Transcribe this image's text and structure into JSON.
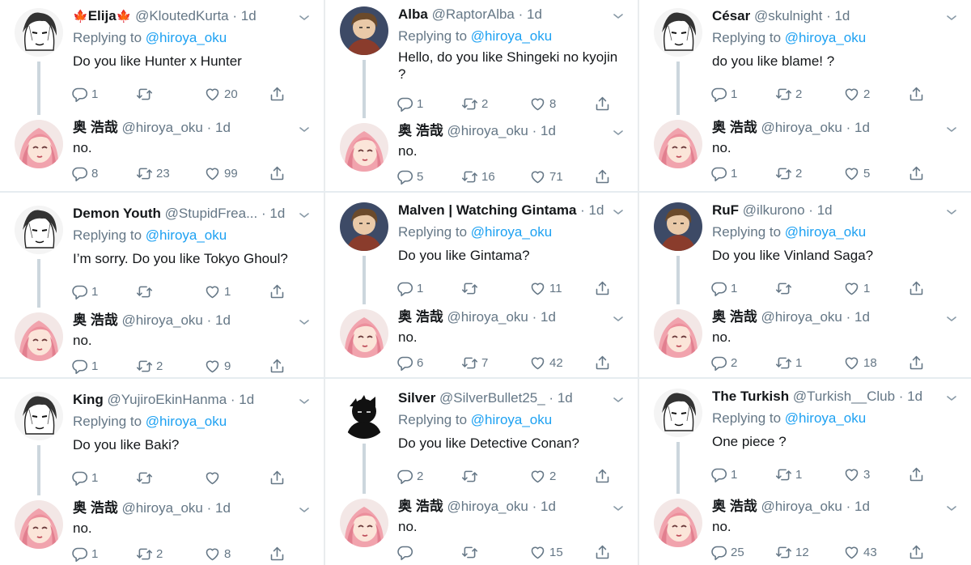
{
  "colors": {
    "link": "#1da1f2",
    "muted": "#657786",
    "text": "#14171a",
    "thread": "#ccd6dd"
  },
  "tiles": [
    {
      "question": {
        "name": "Elija",
        "name_emoji": "maple-leaf",
        "handle": "@KloutedKurta",
        "time": "1d",
        "replying_label": "Replying to",
        "mention": "@hiroya_oku",
        "text": "Do you like Hunter x Hunter",
        "stats": {
          "reply": "1",
          "retweet": "",
          "like": "20"
        },
        "avatar_icon": "manga-face-icon"
      },
      "answer": {
        "name": "奥 浩哉",
        "handle": "@hiroya_oku",
        "time": "1d",
        "text": "no.",
        "stats": {
          "reply": "8",
          "retweet": "23",
          "like": "99"
        },
        "avatar_icon": "pink-hair-avatar"
      }
    },
    {
      "question": {
        "name": "Alba",
        "handle": "@RaptorAlba",
        "time": "1d",
        "replying_label": "Replying to",
        "mention": "@hiroya_oku",
        "text": "Hello, do you like Shingeki no kyojin ?",
        "stats": {
          "reply": "1",
          "retweet": "2",
          "like": "8"
        },
        "avatar_icon": "anime-character-icon"
      },
      "answer": {
        "name": "奥 浩哉",
        "handle": "@hiroya_oku",
        "time": "1d",
        "text": "no.",
        "stats": {
          "reply": "5",
          "retweet": "16",
          "like": "71"
        },
        "avatar_icon": "pink-hair-avatar"
      }
    },
    {
      "question": {
        "name": "César",
        "handle": "@skulnight",
        "time": "1d",
        "replying_label": "Replying to",
        "mention": "@hiroya_oku",
        "text": "do you like blame! ?",
        "stats": {
          "reply": "1",
          "retweet": "2",
          "like": "2"
        },
        "avatar_icon": "manga-face-icon"
      },
      "answer": {
        "name": "奥 浩哉",
        "handle": "@hiroya_oku",
        "time": "1d",
        "text": "no.",
        "stats": {
          "reply": "1",
          "retweet": "2",
          "like": "5"
        },
        "avatar_icon": "pink-hair-avatar"
      }
    },
    {
      "question": {
        "name": "Demon Youth",
        "handle": "@StupidFrea...",
        "time": "1d",
        "replying_label": "Replying to",
        "mention": "@hiroya_oku",
        "text": "I’m sorry. Do you like Tokyo Ghoul?",
        "stats": {
          "reply": "1",
          "retweet": "",
          "like": "1"
        },
        "avatar_icon": "manga-face-icon"
      },
      "answer": {
        "name": "奥 浩哉",
        "handle": "@hiroya_oku",
        "time": "1d",
        "text": "no.",
        "stats": {
          "reply": "1",
          "retweet": "2",
          "like": "9"
        },
        "avatar_icon": "pink-hair-avatar"
      }
    },
    {
      "question": {
        "name": "Malven | Watching Gintama",
        "handle": "",
        "time": "1d",
        "replying_label": "Replying to",
        "mention": "@hiroya_oku",
        "text": "Do you like Gintama?",
        "stats": {
          "reply": "1",
          "retweet": "",
          "like": "11"
        },
        "avatar_icon": "anime-character-icon"
      },
      "answer": {
        "name": "奥 浩哉",
        "handle": "@hiroya_oku",
        "time": "1d",
        "text": "no.",
        "stats": {
          "reply": "6",
          "retweet": "7",
          "like": "42"
        },
        "avatar_icon": "pink-hair-avatar"
      }
    },
    {
      "question": {
        "name": "RuF",
        "handle": "@ilkurono",
        "time": "1d",
        "replying_label": "Replying to",
        "mention": "@hiroya_oku",
        "text": "Do you like Vinland Saga?",
        "stats": {
          "reply": "1",
          "retweet": "",
          "like": "1"
        },
        "avatar_icon": "anime-character-icon"
      },
      "answer": {
        "name": "奥 浩哉",
        "handle": "@hiroya_oku",
        "time": "1d",
        "text": "no.",
        "stats": {
          "reply": "2",
          "retweet": "1",
          "like": "18"
        },
        "avatar_icon": "pink-hair-avatar"
      }
    },
    {
      "question": {
        "name": "King",
        "handle": "@YujiroEkinHanma",
        "time": "1d",
        "replying_label": "Replying to",
        "mention": "@hiroya_oku",
        "text": "Do you like Baki?",
        "stats": {
          "reply": "1",
          "retweet": "",
          "like": ""
        },
        "avatar_icon": "manga-face-icon"
      },
      "answer": {
        "name": "奥 浩哉",
        "handle": "@hiroya_oku",
        "time": "1d",
        "text": "no.",
        "stats": {
          "reply": "1",
          "retweet": "2",
          "like": "8"
        },
        "avatar_icon": "pink-hair-avatar"
      }
    },
    {
      "question": {
        "name": "Silver",
        "handle": "@SilverBullet25_",
        "time": "1d",
        "replying_label": "Replying to",
        "mention": "@hiroya_oku",
        "text": "Do you like Detective Conan?",
        "stats": {
          "reply": "2",
          "retweet": "",
          "like": "2"
        },
        "avatar_icon": "silhouette-icon"
      },
      "answer": {
        "name": "奥 浩哉",
        "handle": "@hiroya_oku",
        "time": "1d",
        "text": "no.",
        "stats": {
          "reply": "",
          "retweet": "",
          "like": "15"
        },
        "avatar_icon": "pink-hair-avatar"
      }
    },
    {
      "question": {
        "name": "The Turkish",
        "handle": "@Turkish__Club",
        "time": "1d",
        "replying_label": "Replying to",
        "mention": "@hiroya_oku",
        "text": "One piece ?",
        "stats": {
          "reply": "1",
          "retweet": "1",
          "like": "3"
        },
        "avatar_icon": "manga-face-icon"
      },
      "answer": {
        "name": "奥 浩哉",
        "handle": "@hiroya_oku",
        "time": "1d",
        "text": "no.",
        "stats": {
          "reply": "25",
          "retweet": "12",
          "like": "43"
        },
        "avatar_icon": "pink-hair-avatar"
      }
    }
  ]
}
